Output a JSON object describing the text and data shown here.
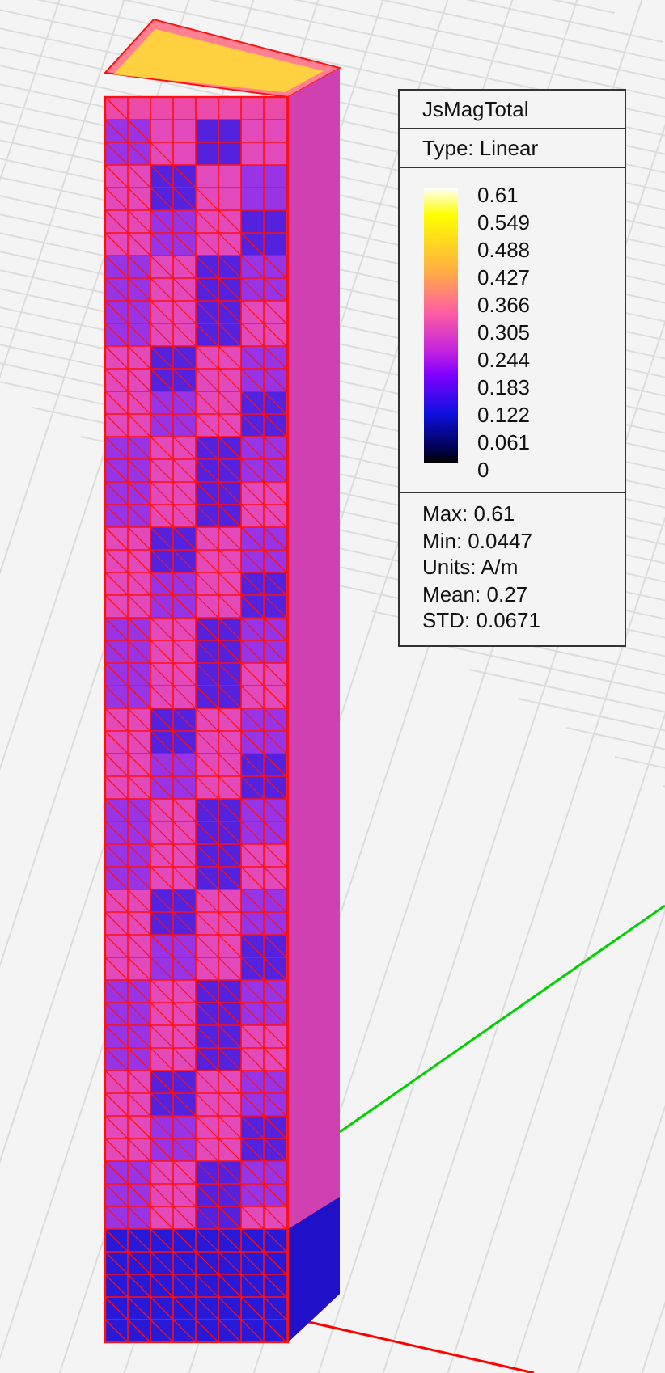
{
  "legend": {
    "title": "JsMagTotal",
    "type": "Type: Linear",
    "ticks": [
      "0.61",
      "0.549",
      "0.488",
      "0.427",
      "0.366",
      "0.305",
      "0.244",
      "0.183",
      "0.122",
      "0.061",
      "0"
    ],
    "stats": [
      "Max: 0.61",
      "Min: 0.0447",
      "Units: A/m",
      "Mean: 0.27",
      "STD: 0.0671"
    ]
  }
}
